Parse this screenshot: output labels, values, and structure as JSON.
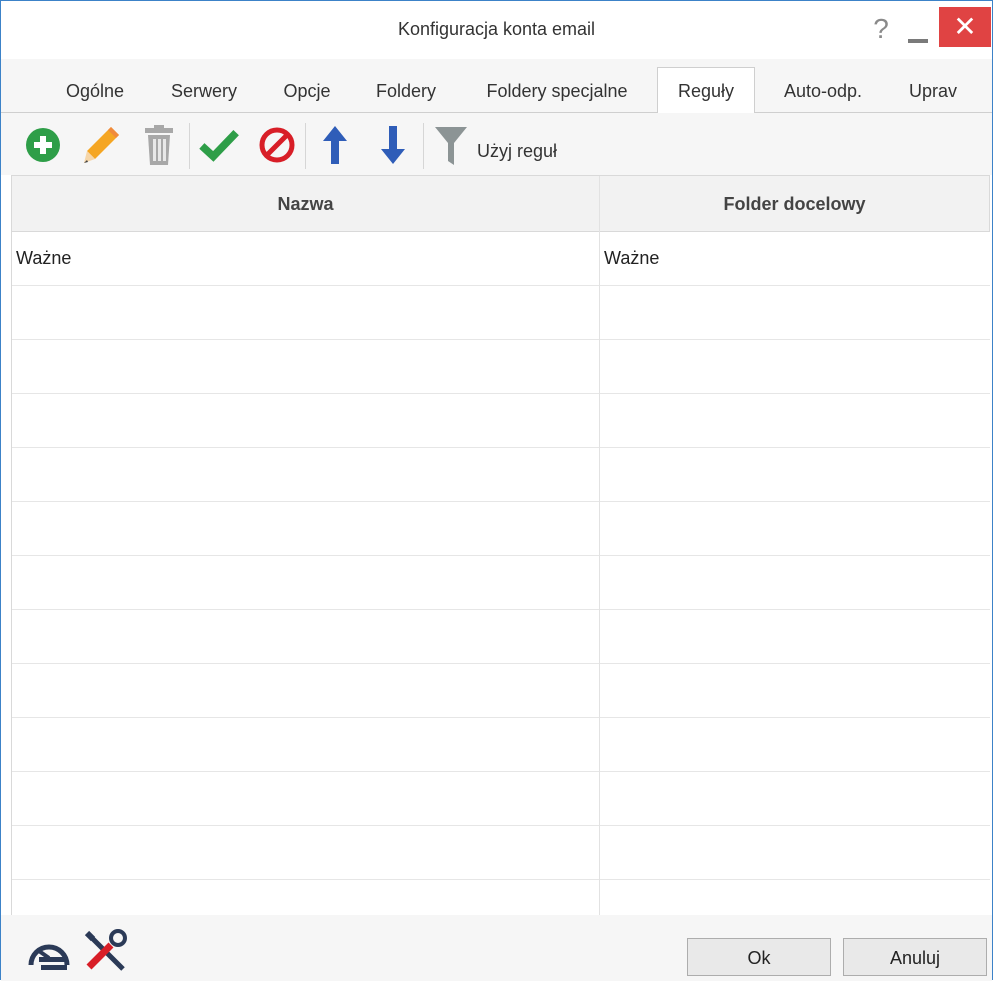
{
  "window": {
    "title": "Konfiguracja konta email",
    "help_glyph": "?",
    "close_glyph": "✕"
  },
  "tabs": [
    {
      "label": "Ogólne"
    },
    {
      "label": "Serwery"
    },
    {
      "label": "Opcje"
    },
    {
      "label": "Foldery"
    },
    {
      "label": "Foldery specjalne"
    },
    {
      "label": "Reguły",
      "active": true
    },
    {
      "label": "Auto-odp."
    },
    {
      "label": "Uprav"
    }
  ],
  "toolbar": {
    "icons": [
      "add-icon",
      "edit-icon",
      "delete-icon",
      "enable-icon",
      "disable-icon",
      "move-up-icon",
      "move-down-icon",
      "filter-icon"
    ],
    "apply_label": "Użyj reguł"
  },
  "table": {
    "columns": [
      "Nazwa",
      "Folder docelowy"
    ],
    "rows": [
      {
        "name": "Ważne",
        "folder": "Ważne"
      }
    ]
  },
  "footer": {
    "icons": [
      "speedometer-icon",
      "tools-icon"
    ],
    "ok_label": "Ok",
    "cancel_label": "Anuluj"
  },
  "colors": {
    "accent": "#3c82c8",
    "close": "#e04343",
    "green": "#2e9e48",
    "red": "#d81e27",
    "blue": "#2f5db8"
  }
}
